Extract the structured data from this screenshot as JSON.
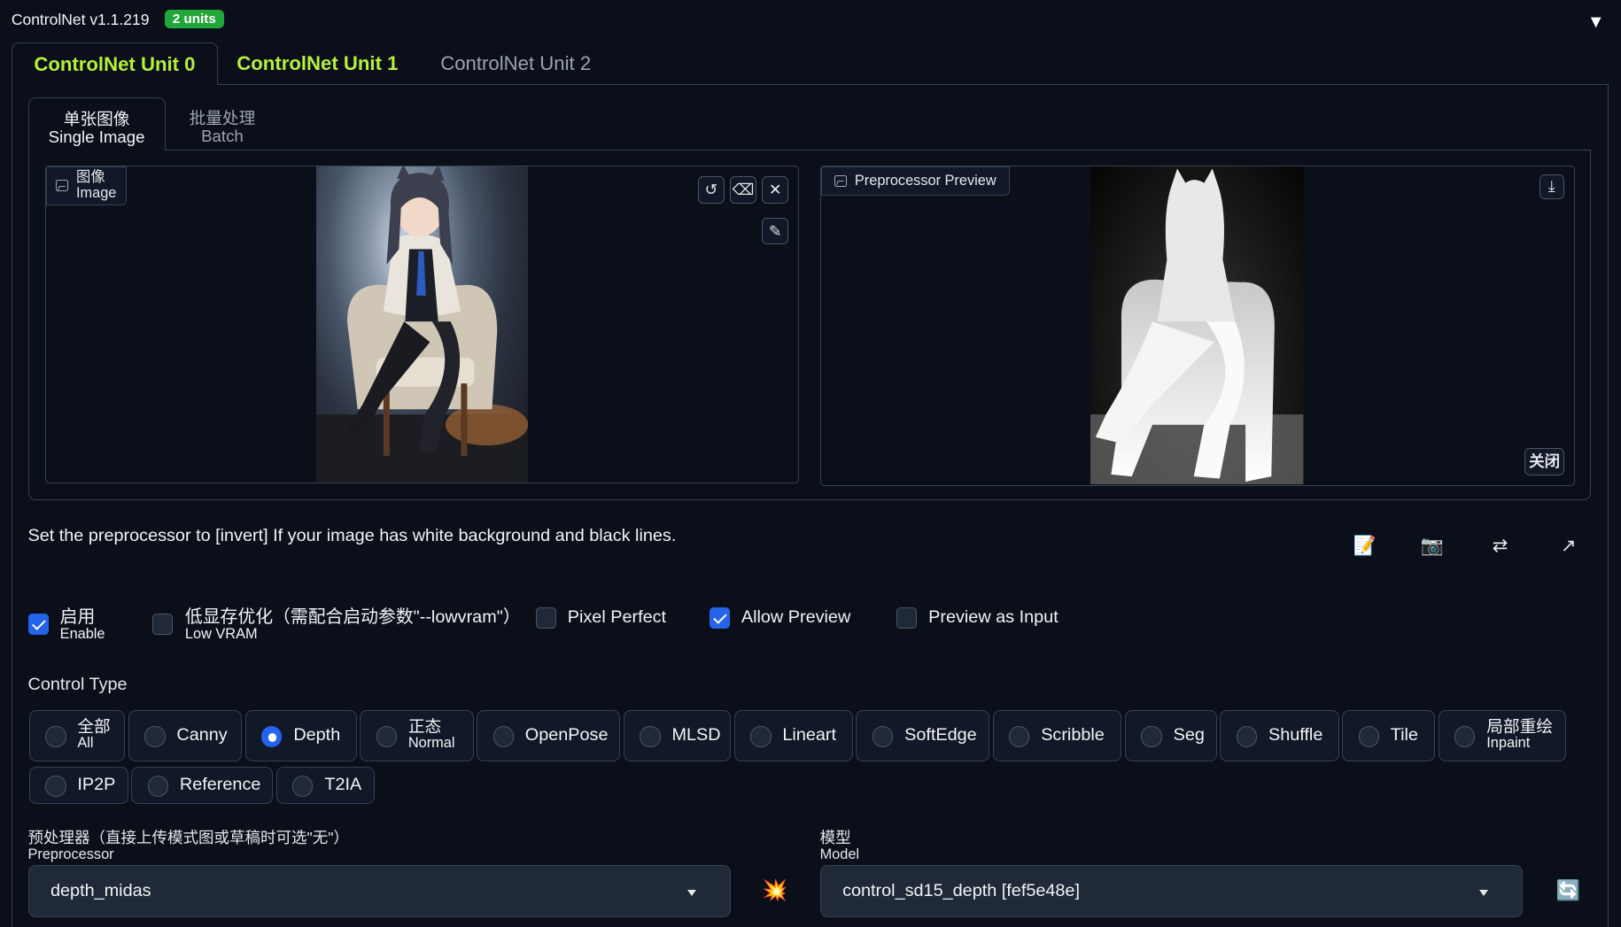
{
  "header": {
    "title": "ControlNet v1.1.219",
    "badge": "2 units",
    "collapse_icon": "▼"
  },
  "unit_tabs": [
    "ControlNet Unit 0",
    "ControlNet Unit 1",
    "ControlNet Unit 2"
  ],
  "image_tabs": [
    {
      "cn": "单张图像",
      "en": "Single Image"
    },
    {
      "cn": "批量处理",
      "en": "Batch"
    }
  ],
  "image_box": {
    "label_cn": "图像",
    "label_en": "Image"
  },
  "preview_box": {
    "label": "Preprocessor Preview",
    "close": "关闭"
  },
  "hint": "Set the preprocessor to [invert] If your image has white background and black lines.",
  "checkboxes": [
    {
      "cn": "启用",
      "en": "Enable",
      "checked": true
    },
    {
      "cn": "低显存优化（需配合启动参数\"--lowvram\"）",
      "en": "Low VRAM",
      "checked": false
    },
    {
      "label": "Pixel Perfect",
      "checked": false
    },
    {
      "label": "Allow Preview",
      "checked": true
    },
    {
      "label": "Preview as Input",
      "checked": false
    }
  ],
  "control_type": {
    "label": "Control Type",
    "options": [
      {
        "cn": "全部",
        "en": "All"
      },
      {
        "label": "Canny"
      },
      {
        "label": "Depth",
        "selected": true
      },
      {
        "cn": "正态",
        "en": "Normal"
      },
      {
        "label": "OpenPose"
      },
      {
        "label": "MLSD"
      },
      {
        "label": "Lineart"
      },
      {
        "label": "SoftEdge"
      },
      {
        "label": "Scribble"
      },
      {
        "label": "Seg"
      },
      {
        "label": "Shuffle"
      },
      {
        "label": "Tile"
      },
      {
        "cn": "局部重绘",
        "en": "Inpaint"
      },
      {
        "label": "IP2P"
      },
      {
        "label": "Reference"
      },
      {
        "label": "T2IA"
      }
    ]
  },
  "preprocessor": {
    "label_cn": "预处理器（直接上传模式图或草稿时可选\"无\"）",
    "label_en": "Preprocessor",
    "value": "depth_midas"
  },
  "model": {
    "label_cn": "模型",
    "label_en": "Model",
    "value": "control_sd15_depth [fef5e48e]"
  },
  "icons": {
    "run_preprocessor": "💥",
    "refresh": "🔄",
    "new_canvas": "📝",
    "webcam": "📷",
    "swap": "⇄",
    "send_dimensions": "↗"
  },
  "colors": {
    "accent_green": "#b5f03e",
    "badge_green": "#22a83a",
    "check_blue": "#2563eb",
    "background": "#0b0f19"
  }
}
